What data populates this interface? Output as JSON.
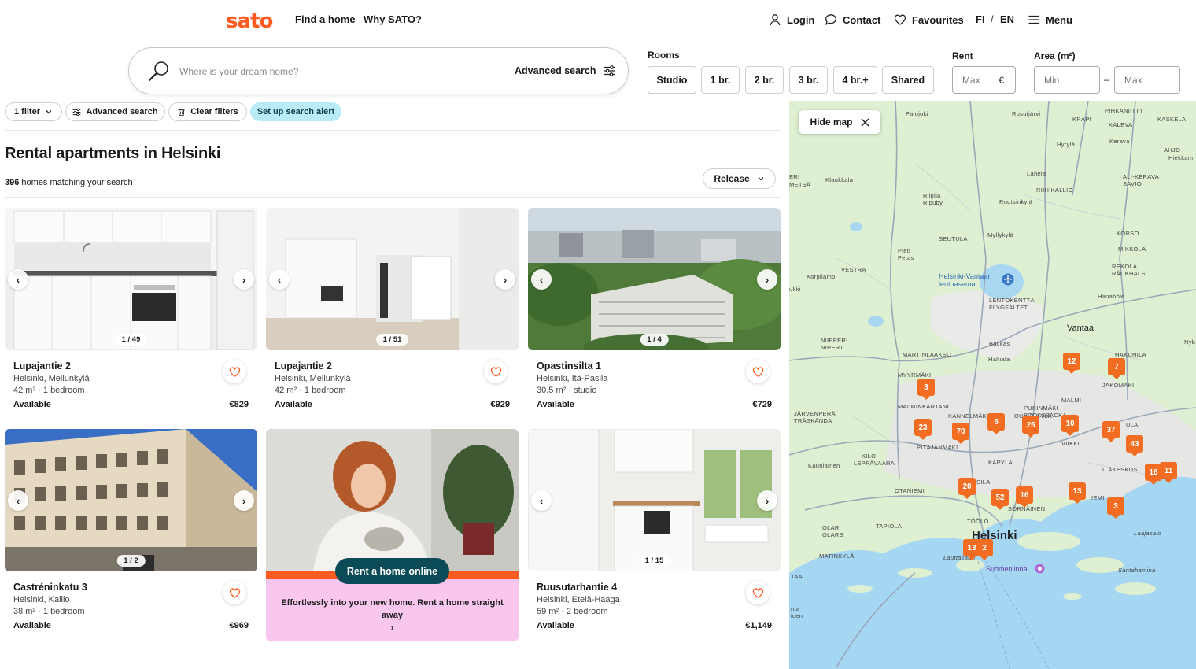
{
  "header": {
    "logo": "sato",
    "nav": [
      "Find a home",
      "Why SATO?"
    ],
    "login": "Login",
    "contact": "Contact",
    "favourites": "Favourites",
    "lang_fi": "FI",
    "lang_sep": "/",
    "lang_en": "EN",
    "menu": "Menu"
  },
  "search": {
    "placeholder": "Where is your dream home?",
    "advanced": "Advanced search"
  },
  "rooms": {
    "label": "Rooms",
    "options": [
      "Studio",
      "1 br.",
      "2 br.",
      "3 br.",
      "4 br.+",
      "Shared"
    ]
  },
  "rent": {
    "label": "Rent",
    "placeholder": "Max",
    "currency": "€"
  },
  "area": {
    "label": "Area (m²)",
    "min_placeholder": "Min",
    "max_placeholder": "Max",
    "separator": "–"
  },
  "filters": {
    "filter_count": "1 filter",
    "advanced": "Advanced search",
    "clear": "Clear filters",
    "alert": "Set up search alert"
  },
  "results": {
    "title": "Rental apartments in Helsinki",
    "count": "396",
    "count_suffix": " homes matching your search",
    "sort": "Release"
  },
  "listings": [
    {
      "title": "Lupajantie 2",
      "location": "Helsinki, Mellunkylä",
      "specs": "42 m² · 1 bedroom",
      "status": "Available",
      "price": "€829",
      "counter": "1 / 49"
    },
    {
      "title": "Lupajantie 2",
      "location": "Helsinki, Mellunkylä",
      "specs": "42 m² · 1 bedroom",
      "status": "Available",
      "price": "€929",
      "counter": "1 / 51"
    },
    {
      "title": "Opastinsilta 1",
      "location": "Helsinki, Itä-Pasila",
      "specs": "30.5 m² · studio",
      "status": "Available",
      "price": "€729",
      "counter": "1 / 4"
    },
    {
      "title": "Castréninkatu 3",
      "location": "Helsinki, Kallio",
      "specs": "38 m² · 1 bedroom",
      "status": "Available",
      "price": "€969",
      "counter": "1 / 2"
    },
    {
      "title": "Ruusutarhantie 4",
      "location": "Helsinki, Etelä-Haaga",
      "specs": "59 m² · 2 bedroom",
      "status": "Available",
      "price": "€1,149",
      "counter": "1 / 15"
    }
  ],
  "promo": {
    "cta": "Rent a home online",
    "text": "Effortlessly into your new home. Rent a home straight away",
    "arrow": "›"
  },
  "map": {
    "hide": "Hide map",
    "markers": [
      "12",
      "7",
      "3",
      "5",
      "25",
      "10",
      "37",
      "43",
      "23",
      "70",
      "20",
      "52",
      "16",
      "13",
      "3",
      "16",
      "11",
      "13",
      "2"
    ],
    "places": {
      "palojoki": "Palojoki",
      "rusutjarvi": "Rusutjärvi",
      "pihkaniitty": "PIHKANIITTY",
      "kaskela": "KASKELA",
      "krapi": "KRAPI",
      "kaleva": "KALEVA",
      "hyryla": "Hyrylä",
      "kerava": "Kerava",
      "ahjo": "AHJO",
      "hiekkaharju": "Hiekkam",
      "klaukkala": "Klaukkala",
      "lahela": "Lahela",
      "riihikallio": "RIIHIKALLIO",
      "alikerava": "ALI-KERAVA",
      "savio": "SAVIO",
      "riipila": "Riipilä Ripuby",
      "ruotsinkyla": "Ruotsinkylä",
      "metsa": "METSÄ",
      "eri": "ERI",
      "seutula": "SEUTULA",
      "myllykyla": "Myllykylä",
      "korso": "KORSO",
      "pieti": "Pieti Petas",
      "mikkola": "MIKKOLA",
      "vestra": "VESTRA",
      "korpilampi": "Korpilampi",
      "rekola": "REKOLA RÅCKHALS",
      "airport": "Helsinki-Vantaan lentoasema",
      "ukki": "ukki",
      "lentokentta": "LENTOKENTTÄ FLYGFÄLTET",
      "hanabole": "Hanaböle",
      "vantaa": "Vantaa",
      "niipperi": "NIIPPERI NIPERT",
      "backas": "Backas",
      "hakunila": "HAKUNILA",
      "nybacka": "Nyb",
      "martinlaakso": "MARTINLAAKSO",
      "haltiala": "Haltiala",
      "myyrmaki": "MYYRMÄKI",
      "jakomaki": "JAKOMÄKI",
      "malminkartano": "MALMINKARTANO",
      "kannelmaki": "KANNELMÄKI",
      "malmi": "MALMI",
      "pukinmaki": "PUKINMÄKI BOCKSBACKA",
      "jarvenpera": "JÄRVENPERÄ TRÄSKÄNDA",
      "pitajanmaki": "PITÄJÄNMÄKI",
      "oulunkyla": "OULUNKYLÄ",
      "viikki": "VIIKKI",
      "ula": "ULA",
      "kilo": "KILO",
      "leppavaara": "LEPPÄVAARA",
      "kauniainen": "Kauniainen",
      "kapyla": "KÄPYLÄ",
      "itakeskus": "ITÄKESKUS",
      "pasila": "PASILA",
      "otaniemi": "OTANIEMI",
      "sornainen": "SÖRNÄINEN",
      "herttoniemi": "IEMI",
      "toolo": "TÖÖLÖ",
      "helsinki": "Helsinki",
      "tapiola": "TAPIOLA",
      "olari": "OLARI OLARS",
      "laajasalo": "Laajasalo",
      "matinkyla": "MATINKYLÄ",
      "lauttasaari": "Lauttasaari",
      "suomenlinna": "Suomenlinna",
      "santahamina": "Santahamina",
      "taa": "TAA",
      "ntaiden": "nta iden"
    }
  },
  "colors": {
    "brand": "#ff5a1f",
    "alert_chip": "#b9ecf7",
    "cta": "#0b4b58",
    "promo_bg": "#f9c7ee",
    "marker": "#f26d21"
  }
}
